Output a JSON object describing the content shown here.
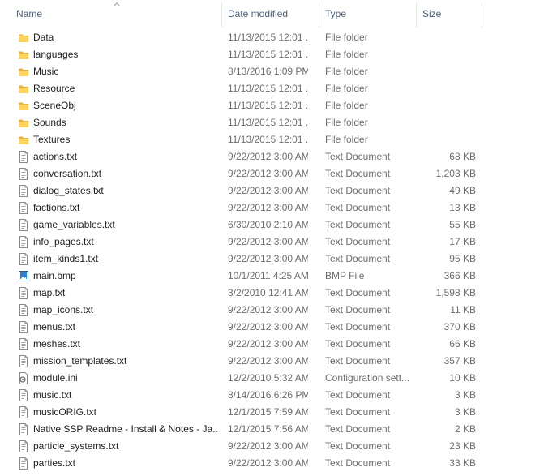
{
  "columns": {
    "name": "Name",
    "date_modified": "Date modified",
    "type": "Type",
    "size": "Size"
  },
  "files": [
    {
      "icon": "folder-icon",
      "name": "Data",
      "date": "11/13/2015 12:01 ...",
      "type": "File folder",
      "size": ""
    },
    {
      "icon": "folder-icon",
      "name": "languages",
      "date": "11/13/2015 12:01 ...",
      "type": "File folder",
      "size": ""
    },
    {
      "icon": "folder-icon",
      "name": "Music",
      "date": "8/13/2016 1:09 PM",
      "type": "File folder",
      "size": ""
    },
    {
      "icon": "folder-icon",
      "name": "Resource",
      "date": "11/13/2015 12:01 ...",
      "type": "File folder",
      "size": ""
    },
    {
      "icon": "folder-icon",
      "name": "SceneObj",
      "date": "11/13/2015 12:01 ...",
      "type": "File folder",
      "size": ""
    },
    {
      "icon": "folder-icon",
      "name": "Sounds",
      "date": "11/13/2015 12:01 ...",
      "type": "File folder",
      "size": ""
    },
    {
      "icon": "folder-icon",
      "name": "Textures",
      "date": "11/13/2015 12:01 ...",
      "type": "File folder",
      "size": ""
    },
    {
      "icon": "text-file-icon",
      "name": "actions.txt",
      "date": "9/22/2012 3:00 AM",
      "type": "Text Document",
      "size": "68 KB"
    },
    {
      "icon": "text-file-icon",
      "name": "conversation.txt",
      "date": "9/22/2012 3:00 AM",
      "type": "Text Document",
      "size": "1,203 KB"
    },
    {
      "icon": "text-file-icon",
      "name": "dialog_states.txt",
      "date": "9/22/2012 3:00 AM",
      "type": "Text Document",
      "size": "49 KB"
    },
    {
      "icon": "text-file-icon",
      "name": "factions.txt",
      "date": "9/22/2012 3:00 AM",
      "type": "Text Document",
      "size": "13 KB"
    },
    {
      "icon": "text-file-icon",
      "name": "game_variables.txt",
      "date": "6/30/2010 2:10 AM",
      "type": "Text Document",
      "size": "55 KB"
    },
    {
      "icon": "text-file-icon",
      "name": "info_pages.txt",
      "date": "9/22/2012 3:00 AM",
      "type": "Text Document",
      "size": "17 KB"
    },
    {
      "icon": "text-file-icon",
      "name": "item_kinds1.txt",
      "date": "9/22/2012 3:00 AM",
      "type": "Text Document",
      "size": "95 KB"
    },
    {
      "icon": "image-file-icon",
      "name": "main.bmp",
      "date": "10/1/2011 4:25 AM",
      "type": "BMP File",
      "size": "366 KB"
    },
    {
      "icon": "text-file-icon",
      "name": "map.txt",
      "date": "3/2/2010 12:41 AM",
      "type": "Text Document",
      "size": "1,598 KB"
    },
    {
      "icon": "text-file-icon",
      "name": "map_icons.txt",
      "date": "9/22/2012 3:00 AM",
      "type": "Text Document",
      "size": "11 KB"
    },
    {
      "icon": "text-file-icon",
      "name": "menus.txt",
      "date": "9/22/2012 3:00 AM",
      "type": "Text Document",
      "size": "370 KB"
    },
    {
      "icon": "text-file-icon",
      "name": "meshes.txt",
      "date": "9/22/2012 3:00 AM",
      "type": "Text Document",
      "size": "66 KB"
    },
    {
      "icon": "text-file-icon",
      "name": "mission_templates.txt",
      "date": "9/22/2012 3:00 AM",
      "type": "Text Document",
      "size": "357 KB"
    },
    {
      "icon": "config-file-icon",
      "name": "module.ini",
      "date": "12/2/2010 5:32 AM",
      "type": "Configuration sett...",
      "size": "10 KB"
    },
    {
      "icon": "text-file-icon",
      "name": "music.txt",
      "date": "8/14/2016 6:26 PM",
      "type": "Text Document",
      "size": "3 KB"
    },
    {
      "icon": "text-file-icon",
      "name": "musicORIG.txt",
      "date": "12/1/2015 7:59 AM",
      "type": "Text Document",
      "size": "3 KB"
    },
    {
      "icon": "text-file-icon",
      "name": "Native SSP Readme - Install & Notes - Ja...",
      "date": "12/1/2015 7:56 AM",
      "type": "Text Document",
      "size": "2 KB"
    },
    {
      "icon": "text-file-icon",
      "name": "particle_systems.txt",
      "date": "9/22/2012 3:00 AM",
      "type": "Text Document",
      "size": "23 KB"
    },
    {
      "icon": "text-file-icon",
      "name": "parties.txt",
      "date": "9/22/2012 3:00 AM",
      "type": "Text Document",
      "size": "33 KB"
    }
  ]
}
